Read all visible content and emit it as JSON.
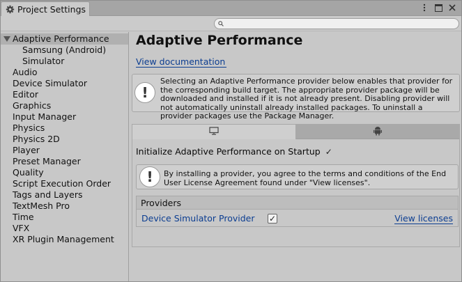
{
  "window": {
    "title": "Project Settings"
  },
  "search": {
    "placeholder": "",
    "value": ""
  },
  "sidebar": {
    "items": [
      {
        "label": "Adaptive Performance",
        "selected": true,
        "expanded": true
      },
      {
        "label": "Samsung (Android)",
        "indent": 1
      },
      {
        "label": "Simulator",
        "indent": 1
      },
      {
        "label": "Audio"
      },
      {
        "label": "Device Simulator"
      },
      {
        "label": "Editor"
      },
      {
        "label": "Graphics"
      },
      {
        "label": "Input Manager"
      },
      {
        "label": "Physics"
      },
      {
        "label": "Physics 2D"
      },
      {
        "label": "Player"
      },
      {
        "label": "Preset Manager"
      },
      {
        "label": "Quality"
      },
      {
        "label": "Script Execution Order"
      },
      {
        "label": "Tags and Layers"
      },
      {
        "label": "TextMesh Pro"
      },
      {
        "label": "Time"
      },
      {
        "label": "VFX"
      },
      {
        "label": "XR Plugin Management"
      }
    ]
  },
  "main": {
    "title": "Adaptive Performance",
    "doc_link": "View documentation",
    "info_text": "Selecting an Adaptive Performance provider below enables that provider for the corresponding build target. The appropriate provider package will be downloaded and installed if it is not already present. Disabling provider will not automatically uninstall already installed packages. To uninstall a provider packages use the Package Manager.",
    "tabs": [
      {
        "icon": "desktop-icon",
        "active": true
      },
      {
        "icon": "android-icon",
        "active": false
      }
    ],
    "init_label": "Initialize Adaptive Performance on Startup",
    "init_checked": true,
    "license_text": "By installing a provider, you agree to the terms and conditions of the End User License Agreement found under \"View licenses\".",
    "providers": {
      "header": "Providers",
      "rows": [
        {
          "name": "Device Simulator Provider",
          "checked": true,
          "licenses_link": "View licenses"
        }
      ]
    }
  },
  "colors": {
    "link": "#0b3d91",
    "selected_row": "#b0b0b0",
    "background": "#c8c8c8"
  }
}
